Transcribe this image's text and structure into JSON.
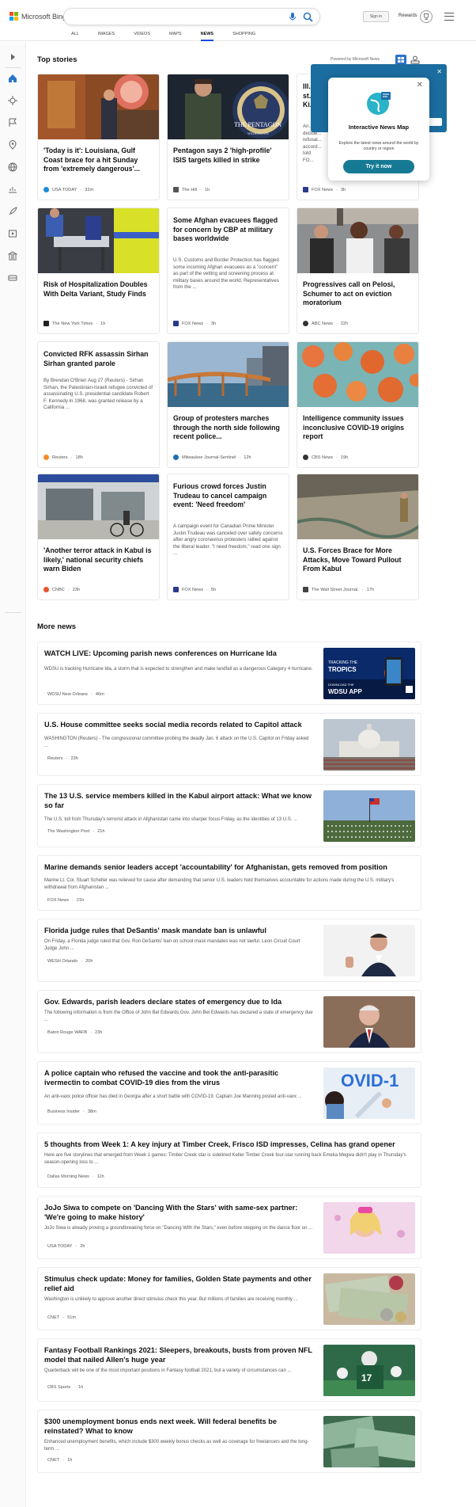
{
  "header": {
    "brand": "Microsoft Bing",
    "sign_in": "Sign in",
    "rewards": "Rewards",
    "tabs": [
      "ALL",
      "IMAGES",
      "VIDEOS",
      "MAPS",
      "NEWS",
      "SHOPPING"
    ],
    "active_tab": "NEWS"
  },
  "top_stories": {
    "heading": "Top stories",
    "powered_by": "Powered by Microsoft News",
    "cards": [
      {
        "title": "'Today is it': Louisiana, Gulf Coast brace for a hit Sunday from 'extremely dangerous'...",
        "desc": "",
        "source": "USA TODAY",
        "time": "32m",
        "fav": "#1a8cd8"
      },
      {
        "title": "Pentagon says 2 'high-profile' ISIS targets killed in strike",
        "desc": "",
        "source": "The Hill",
        "time": "1h",
        "fav": "#555"
      },
      {
        "title": "Ill... st... Ki...",
        "desc": "An... decide... refusal... accord... told FO...",
        "source": "FOX News",
        "time": "3h",
        "fav": "#2a3a8c"
      },
      {
        "title": "Risk of Hospitalization Doubles With Delta Variant, Study Finds",
        "desc": "",
        "source": "The New York Times",
        "time": "1h",
        "fav": "#222"
      },
      {
        "title": "Some Afghan evacuees flagged for concern by CBP at military bases worldwide",
        "desc": "U.S. Customs and Border Protection has flagged some incoming Afghan evacuees as a \"concern\" as part of the vetting and screening process at military bases around the world.  Representatives from the ...",
        "source": "FOX News",
        "time": "3h",
        "fav": "#2a3a8c"
      },
      {
        "title": "Progressives call on Pelosi, Schumer to act on eviction moratorium",
        "desc": "",
        "source": "ABC News",
        "time": "22h",
        "fav": "#333"
      },
      {
        "title": "Convicted RFK assassin Sirhan Sirhan granted parole",
        "desc": "By Brendan O'Brien Aug 27 (Reuters) - Sirhan Sirhan, the Palestinian-Israeli refugee convicted of assassinating U.S. presidential candidate Robert F. Kennedy in 1968, was granted release by a California ...",
        "source": "Reuters",
        "time": "18h",
        "fav": "#f28c28"
      },
      {
        "title": "Group of protesters marches through the north side following recent police...",
        "desc": "",
        "source": "Milwaukee Journal-Sentinel",
        "time": "12h",
        "fav": "#1a6fb5"
      },
      {
        "title": "Intelligence community issues inconclusive COVID-19 origins report",
        "desc": "",
        "source": "CBS News",
        "time": "19h",
        "fav": "#333"
      },
      {
        "title": "'Another terror attack in Kabul is likely,' national security chiefs warn Biden",
        "desc": "",
        "source": "CNBC",
        "time": "23h",
        "fav": "#e8542c"
      },
      {
        "title": "Furious crowd forces Justin Trudeau to cancel campaign event: 'Need freedom'",
        "desc": "A campaign event for Canadian Prime Minister Justin Trudeau was canceled over safety concerns after angry coronavirus protesters rallied against the liberal leader.  \"I need freedom,\" read one sign ...",
        "source": "FOX News",
        "time": "5h",
        "fav": "#2a3a8c"
      },
      {
        "title": "U.S. Forces Brace for More Attacks, Move Toward Pullout From Kabul",
        "desc": "",
        "source": "The Wall Street Journal.",
        "time": "17h",
        "fav": "#444"
      }
    ]
  },
  "popup": {
    "title": "Interactive News Map",
    "desc": "Explore the latest news around the world by country or region",
    "button": "Try it now"
  },
  "more_news": {
    "heading": "More news",
    "items": [
      {
        "title": "WATCH LIVE: Upcoming parish news conferences on Hurricane Ida",
        "desc": "WDSU is tracking Hurricane Ida, a storm that is expected to strengthen and make landfall as a dangerous Category 4 hurricane.",
        "source": "WDSU New Orleans",
        "time": "46m",
        "fav": "#3b4db0",
        "img_text": [
          "TRACKING THE",
          "TROPICS",
          "DOWNLOAD THE",
          "WDSU APP"
        ]
      },
      {
        "title": "U.S. House committee seeks social media records related to Capitol attack",
        "desc": "WASHINGTON (Reuters) - The congressional committee probing the deadly Jan. 6 attack on the U.S. Capitol on Friday asked ...",
        "source": "Reuters",
        "time": "23h",
        "fav": "#f28c28"
      },
      {
        "title": "The 13 U.S. service members killed in the Kabul airport attack: What we know so far",
        "desc": "The U.S. toll from Thursday's terrorist attack in Afghanistan came into sharper focus Friday, as the identities of 13 U.S. ...",
        "source": "The Washington Post",
        "time": "21h",
        "fav": "#222"
      },
      {
        "title": "Marine demands senior leaders accept 'accountability' for Afghanistan, gets removed from position",
        "desc": "Marine Lt. Col. Stuart Scheller was relieved for cause after demanding that senior U.S. leaders hold themselves accountable for actions made during the U.S. military's withdrawal from Afghanistan ...",
        "source": "FOX News",
        "time": "21h",
        "fav": "#2a3a8c"
      },
      {
        "title": "Florida judge rules that DeSantis' mask mandate ban is unlawful",
        "desc": "On Friday, a Florida judge ruled that Gov. Ron DeSantis' ban on school mask mandates was not lawful. Leon Circuit Court Judge John ...",
        "source": "WESH Orlando",
        "time": "20h",
        "fav": "#2a58b8"
      },
      {
        "title": "Gov. Edwards, parish leaders declare states of emergency due to Ida",
        "desc": "The following information is from the Office of John Bel Edwards:Gov. John Bel Edwards has declared a state of emergency due ...",
        "source": "Baton Rouge WAFB",
        "time": "23h",
        "fav": "#c8b400"
      },
      {
        "title": "A police captain who refused the vaccine and took the anti-parasitic ivermectin to combat COVID-19 dies from the virus",
        "desc": "An anti-vaxx police officer has died in Georgia after a short battle with COVID-19. Captain Joe Manning posted anti-vaxx ...",
        "source": "Business Insider",
        "time": "38m",
        "fav": "#2a6fd8",
        "img_text": [
          "OVID-1"
        ]
      },
      {
        "title": "5 thoughts from Week 1: A key injury at Timber Creek, Frisco ISD impresses, Celina has grand opener",
        "desc": "Here are five storylines that emerged from Week 1 games: Timber Creek star is sidelined Keller Timber Creek four-star running back Emeka Megwa didn't play in Thursday's season-opening loss to ...",
        "source": "Dallas Morning News",
        "time": "11h",
        "fav": "#1e3f8a"
      },
      {
        "title": "JoJo Siwa to compete on 'Dancing With the Stars' with same-sex partner: 'We're going to make history'",
        "desc": "JoJo Siwa is already proving a groundbreaking force on \"Dancing With the Stars,\" even before stepping on the dance floor on ...",
        "source": "USA TODAY",
        "time": "2h",
        "fav": "#1a8cd8"
      },
      {
        "title": "Stimulus check update: Money for families, Golden State payments and other relief aid",
        "desc": "Washington is unlikely to approve another direct stimulus check this year. But millions of families are receiving monthly ...",
        "source": "CNET",
        "time": "51m",
        "fav": "#d0021b"
      },
      {
        "title": "Fantasy Football Rankings 2021: Sleepers, breakouts, busts from proven NFL model that nailed Allen's huge year",
        "desc": "Quarterback will be one of the most important positions in Fantasy football 2021, but a variety of circumstances can ...",
        "source": "CBS Sports",
        "time": "1h",
        "fav": "#1a4ab8"
      },
      {
        "title": "$300 unemployment bonus ends next week. Will federal benefits be reinstated? What to know",
        "desc": "Enhanced unemployment benefits, which include $300 weekly bonus checks as well as coverage for freelancers and the long-term ...",
        "source": "CNET",
        "time": "1h",
        "fav": "#d0021b"
      }
    ]
  },
  "image_labels": {
    "pentagon": "THE PENTAGON",
    "washington": "WASHINGTON"
  }
}
